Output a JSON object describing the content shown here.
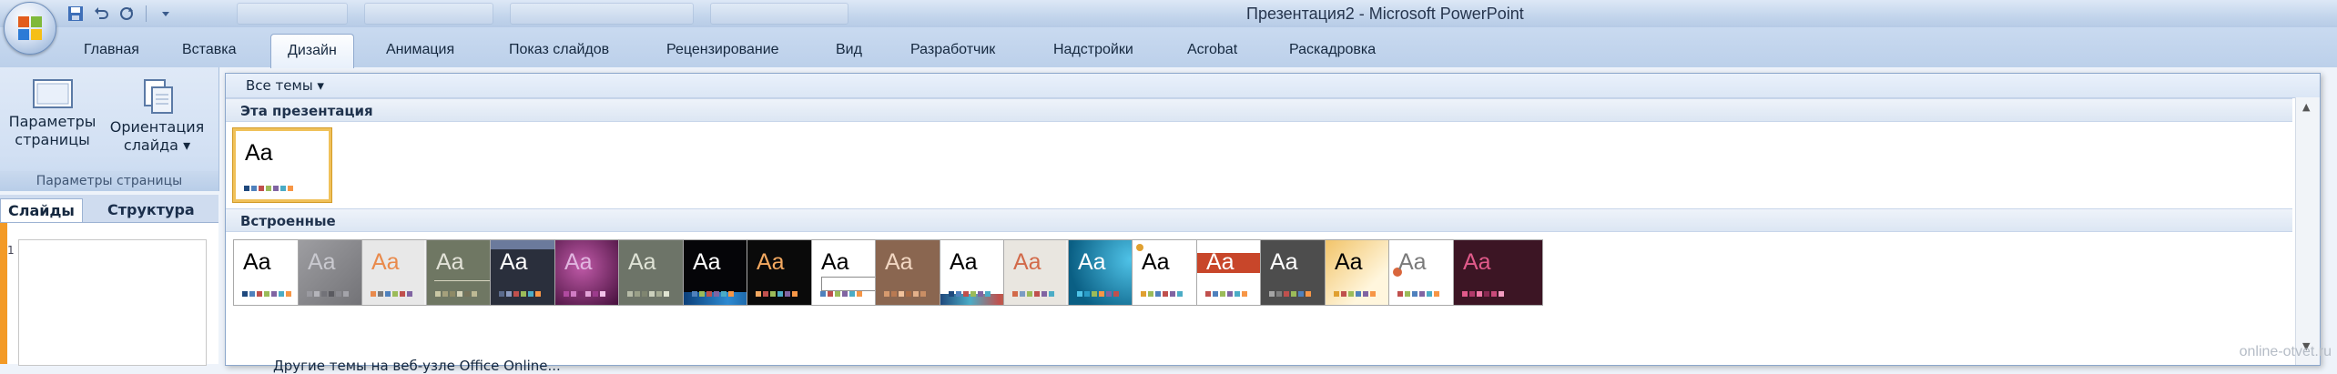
{
  "window": {
    "title": "Презентация2 - Microsoft PowerPoint"
  },
  "ribbon": {
    "tabs": [
      {
        "label": "Главная",
        "active": false
      },
      {
        "label": "Вставка",
        "active": false
      },
      {
        "label": "Дизайн",
        "active": true
      },
      {
        "label": "Анимация",
        "active": false
      },
      {
        "label": "Показ слайдов",
        "active": false
      },
      {
        "label": "Рецензирование",
        "active": false
      },
      {
        "label": "Вид",
        "active": false
      },
      {
        "label": "Разработчик",
        "active": false
      },
      {
        "label": "Надстройки",
        "active": false
      },
      {
        "label": "Acrobat",
        "active": false
      },
      {
        "label": "Раскадровка",
        "active": false
      }
    ],
    "page_setup_group": {
      "page_setup_label": "Параметры\nстраницы",
      "orientation_label": "Ориентация\nслайда ▾",
      "group_label": "Параметры страницы"
    }
  },
  "slides_pane": {
    "tabs": [
      "Слайды",
      "Структура"
    ],
    "slide_number": "1"
  },
  "themes_gallery": {
    "all_themes_label": "Все темы ▾",
    "section_this": "Эта презентация",
    "section_builtin": "Встроенные",
    "more_online_label": "Другие темы на веб-узле Office Online...",
    "aa_text": "Aa",
    "current_theme": {
      "bg": "#ffffff",
      "text": "#000000",
      "swatches": [
        "#1f497d",
        "#4f81bd",
        "#c0504d",
        "#9bbb59",
        "#8064a2",
        "#4bacc6",
        "#f79646"
      ]
    },
    "builtin_themes": [
      {
        "bg": "#ffffff",
        "text": "#000000",
        "deco": "none",
        "swatches": [
          "#1f497d",
          "#4f81bd",
          "#c0504d",
          "#9bbb59",
          "#8064a2",
          "#4bacc6",
          "#f79646"
        ]
      },
      {
        "bg": "#7d7d82",
        "text": "#c9c9cf",
        "deco": "diagonal",
        "swatches": [
          "#9a9aa0",
          "#b4b4ba",
          "#727278",
          "#5a5a60",
          "#8a8a90",
          "#a4a4aa"
        ]
      },
      {
        "bg": "#e8e8e8",
        "text": "#e98a4c",
        "deco": "right-gray",
        "swatches": [
          "#e98a4c",
          "#7b7b7b",
          "#4f81bd",
          "#9bbb59",
          "#c0504d",
          "#8064a2"
        ]
      },
      {
        "bg": "#6f7763",
        "text": "#e3e3d8",
        "deco": "line",
        "swatches": [
          "#c9c7a4",
          "#a5a07c",
          "#8e8a66",
          "#d6d3b8",
          "#77735a",
          "#bdb994"
        ]
      },
      {
        "bg": "#2a2f3c",
        "text": "#ffffff",
        "deco": "band",
        "swatches": [
          "#5b6b8c",
          "#8a9abf",
          "#c0504d",
          "#9bbb59",
          "#4bacc6",
          "#f79646"
        ]
      },
      {
        "bg": "#6a1f5a",
        "text": "#e1b6e0",
        "deco": "purple",
        "swatches": [
          "#b04aa0",
          "#d07cc4",
          "#7a2a6a",
          "#e2a3d8",
          "#9c3b8c",
          "#f2c3ea"
        ]
      },
      {
        "bg": "#6d7468",
        "text": "#dfe3d6",
        "deco": "none",
        "swatches": [
          "#b7bca8",
          "#9aa088",
          "#7f8570",
          "#ccd1bd",
          "#a6ac94",
          "#e0e4d2"
        ]
      },
      {
        "bg": "#050508",
        "text": "#ffffff",
        "deco": "bottom-blue",
        "swatches": [
          "#4f81bd",
          "#9bbb59",
          "#c0504d",
          "#8064a2",
          "#4bacc6",
          "#f79646"
        ]
      },
      {
        "bg": "#0a0a0a",
        "text": "#f2a860",
        "deco": "none",
        "swatches": [
          "#f2a860",
          "#c0504d",
          "#9bbb59",
          "#4bacc6",
          "#8064a2",
          "#f79646"
        ]
      },
      {
        "bg": "#ffffff",
        "text": "#000000",
        "deco": "box",
        "swatches": [
          "#4f81bd",
          "#c0504d",
          "#9bbb59",
          "#8064a2",
          "#4bacc6",
          "#f79646"
        ]
      },
      {
        "bg": "#8a6650",
        "text": "#f2d7c2",
        "deco": "none",
        "swatches": [
          "#d69a6e",
          "#b97a52",
          "#f2c39c",
          "#a86a44",
          "#e3b08a",
          "#c98e64"
        ]
      },
      {
        "bg": "#ffffff",
        "text": "#000000",
        "deco": "bottom-wave",
        "swatches": [
          "#1f497d",
          "#4f81bd",
          "#c0504d",
          "#9bbb59",
          "#8064a2",
          "#4bacc6"
        ]
      },
      {
        "bg": "#e9e6e0",
        "text": "#d26a4a",
        "deco": "right-gray",
        "swatches": [
          "#d26a4a",
          "#7b9cc3",
          "#9bbb59",
          "#c0504d",
          "#8064a2",
          "#4bacc6"
        ]
      },
      {
        "bg": "#127fa6",
        "text": "#ffffff",
        "deco": "teal",
        "swatches": [
          "#4fc3e8",
          "#2a9dc8",
          "#9bbb59",
          "#f79646",
          "#8064a2",
          "#c0504d"
        ]
      },
      {
        "bg": "#ffffff",
        "text": "#000000",
        "deco": "dots",
        "swatches": [
          "#e0a030",
          "#9bbb59",
          "#4f81bd",
          "#c0504d",
          "#8064a2",
          "#4bacc6"
        ]
      },
      {
        "bg": "#ffffff",
        "text": "#ffffff",
        "deco": "red-band",
        "swatches": [
          "#c0504d",
          "#4f81bd",
          "#9bbb59",
          "#8064a2",
          "#4bacc6",
          "#f79646"
        ]
      },
      {
        "bg": "#4d4d4d",
        "text": "#ffffff",
        "deco": "none",
        "swatches": [
          "#a5a5a5",
          "#7f7f7f",
          "#c0504d",
          "#9bbb59",
          "#4f81bd",
          "#f79646"
        ]
      },
      {
        "bg": "#fbeed0",
        "text": "#000000",
        "deco": "gold",
        "swatches": [
          "#e0a030",
          "#c0504d",
          "#9bbb59",
          "#4f81bd",
          "#8064a2",
          "#f79646"
        ]
      },
      {
        "bg": "#ffffff",
        "text": "#7a7a7a",
        "deco": "left-dot",
        "swatches": [
          "#c0504d",
          "#9bbb59",
          "#4f81bd",
          "#8064a2",
          "#4bacc6",
          "#f79646"
        ]
      },
      {
        "bg": "#3c1524",
        "text": "#e05a8a",
        "deco": "none",
        "swatches": [
          "#e05a8a",
          "#b03a6a",
          "#f07aa8",
          "#8a2a52",
          "#c84a7a",
          "#f29cc0"
        ]
      }
    ]
  },
  "watermark": "online-otvet.ru",
  "colors": {
    "accent": "#f0c15a",
    "ribbon": "#c9daf0",
    "active_pane_edge": "#f39a26"
  }
}
